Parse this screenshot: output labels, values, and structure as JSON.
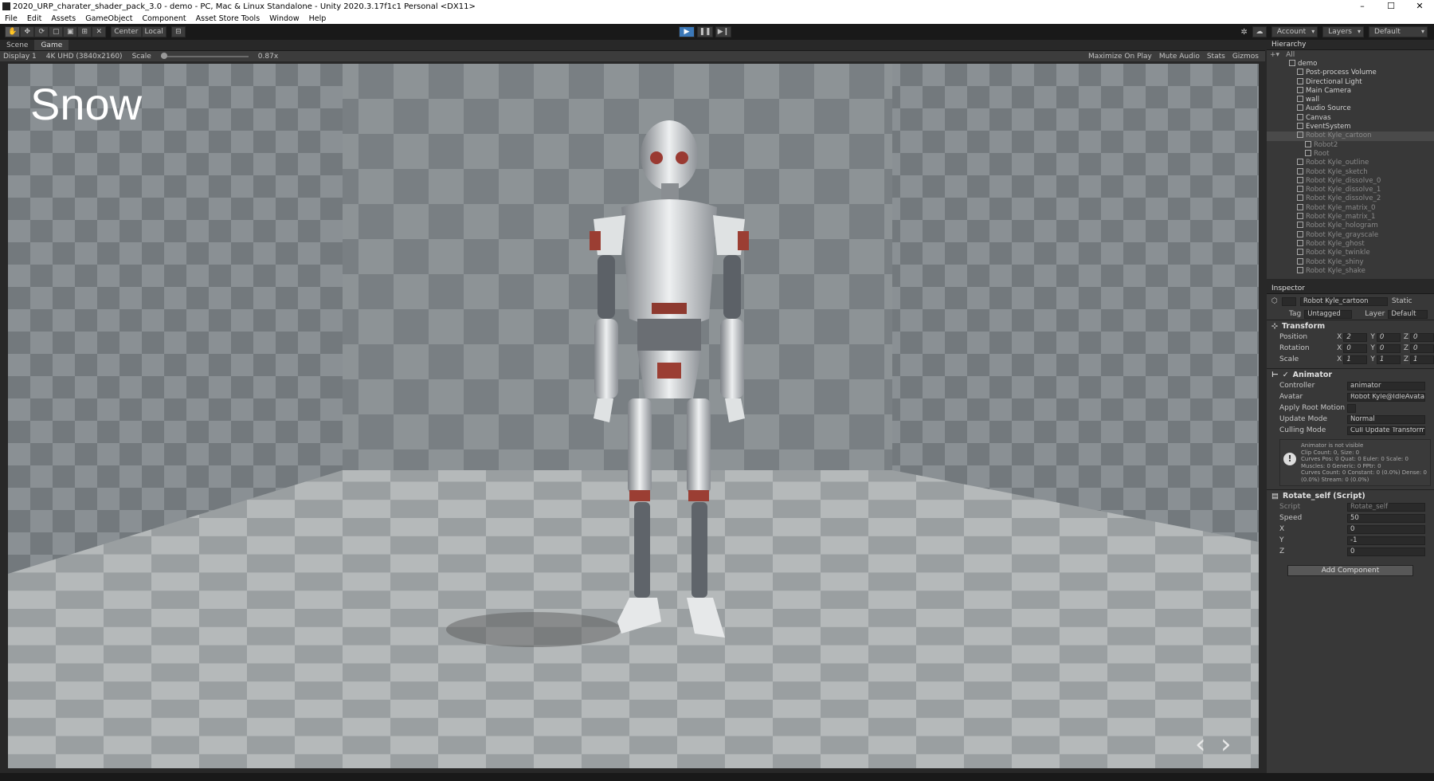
{
  "window": {
    "title": "2020_URP_charater_shader_pack_3.0 - demo - PC, Mac & Linux Standalone - Unity 2020.3.17f1c1 Personal <DX11>",
    "minimize": "–",
    "maximize": "☐",
    "close": "✕"
  },
  "menu": [
    "File",
    "Edit",
    "Assets",
    "GameObject",
    "Component",
    "Asset Store Tools",
    "Window",
    "Help"
  ],
  "toolbar": {
    "tools": [
      "✋",
      "✥",
      "⟳",
      "▢",
      "▣",
      "⊞",
      "✕"
    ],
    "pivot": "Center",
    "space": "Local",
    "play": "▶",
    "pause": "❚❚",
    "step": "▶❙",
    "account": "Account",
    "layers": "Layers",
    "layout": "Default"
  },
  "game": {
    "tabs": [
      "Scene",
      "Game"
    ],
    "display": "Display 1",
    "resolution": "4K UHD (3840x2160)",
    "scale_label": "Scale",
    "scale_value": "0.87x",
    "options": [
      "Maximize On Play",
      "Mute Audio",
      "Stats",
      "Gizmos"
    ],
    "title": "Snow",
    "prev": "‹",
    "next": "›"
  },
  "hierarchy": {
    "title": "Hierarchy",
    "search": "All",
    "items": [
      {
        "name": "demo",
        "dim": false,
        "depth": 0,
        "sel": false
      },
      {
        "name": "Post-process Volume",
        "dim": false,
        "depth": 1,
        "sel": false
      },
      {
        "name": "Directional Light",
        "dim": false,
        "depth": 1,
        "sel": false
      },
      {
        "name": "Main Camera",
        "dim": false,
        "depth": 1,
        "sel": false
      },
      {
        "name": "wall",
        "dim": false,
        "depth": 1,
        "sel": false
      },
      {
        "name": "Audio Source",
        "dim": false,
        "depth": 1,
        "sel": false
      },
      {
        "name": "Canvas",
        "dim": false,
        "depth": 1,
        "sel": false
      },
      {
        "name": "EventSystem",
        "dim": false,
        "depth": 1,
        "sel": false
      },
      {
        "name": "Robot Kyle_cartoon",
        "dim": true,
        "depth": 1,
        "sel": true
      },
      {
        "name": "Robot2",
        "dim": true,
        "depth": 2,
        "sel": false
      },
      {
        "name": "Root",
        "dim": true,
        "depth": 2,
        "sel": false
      },
      {
        "name": "Robot Kyle_outline",
        "dim": true,
        "depth": 1,
        "sel": false
      },
      {
        "name": "Robot Kyle_sketch",
        "dim": true,
        "depth": 1,
        "sel": false
      },
      {
        "name": "Robot Kyle_dissolve_0",
        "dim": true,
        "depth": 1,
        "sel": false
      },
      {
        "name": "Robot Kyle_dissolve_1",
        "dim": true,
        "depth": 1,
        "sel": false
      },
      {
        "name": "Robot Kyle_dissolve_2",
        "dim": true,
        "depth": 1,
        "sel": false
      },
      {
        "name": "Robot Kyle_matrix_0",
        "dim": true,
        "depth": 1,
        "sel": false
      },
      {
        "name": "Robot Kyle_matrix_1",
        "dim": true,
        "depth": 1,
        "sel": false
      },
      {
        "name": "Robot Kyle_hologram",
        "dim": true,
        "depth": 1,
        "sel": false
      },
      {
        "name": "Robot Kyle_grayscale",
        "dim": true,
        "depth": 1,
        "sel": false
      },
      {
        "name": "Robot Kyle_ghost",
        "dim": true,
        "depth": 1,
        "sel": false
      },
      {
        "name": "Robot Kyle_twinkle",
        "dim": true,
        "depth": 1,
        "sel": false
      },
      {
        "name": "Robot Kyle_shiny",
        "dim": true,
        "depth": 1,
        "sel": false
      },
      {
        "name": "Robot Kyle_shake",
        "dim": true,
        "depth": 1,
        "sel": false
      }
    ]
  },
  "inspector": {
    "title": "Inspector",
    "object_name": "Robot Kyle_cartoon",
    "static": "Static",
    "tag_label": "Tag",
    "tag": "Untagged",
    "layer_label": "Layer",
    "layer": "Default",
    "transform": {
      "title": "Transform",
      "position_label": "Position",
      "position": [
        "2",
        "0",
        "0"
      ],
      "rotation_label": "Rotation",
      "rotation": [
        "0",
        "0",
        "0"
      ],
      "scale_label": "Scale",
      "scale": [
        "1",
        "1",
        "1"
      ]
    },
    "animator": {
      "title": "Animator",
      "controller_label": "Controller",
      "controller": "animator",
      "avatar_label": "Avatar",
      "avatar": "Robot Kyle@IdleAvatar",
      "root_motion_label": "Apply Root Motion",
      "update_label": "Update Mode",
      "update": "Normal",
      "culling_label": "Culling Mode",
      "culling": "Cull Update Transforms",
      "info": [
        "Animator is not visible",
        "Clip Count: 0, Size: 0",
        "Curves Pos: 0 Quat: 0 Euler: 0 Scale: 0",
        "Muscles: 0 Generic: 0 PPtr: 0",
        "Curves Count: 0 Constant: 0 (0.0%) Dense: 0",
        "(0.0%) Stream: 0 (0.0%)"
      ]
    },
    "rotate": {
      "title": "Rotate_self (Script)",
      "script_label": "Script",
      "script": "Rotate_self",
      "speed_label": "Speed",
      "speed": "50",
      "x_label": "X",
      "x": "0",
      "y_label": "Y",
      "y": "-1",
      "z_label": "Z",
      "z": "0"
    },
    "add_component": "Add Component"
  }
}
